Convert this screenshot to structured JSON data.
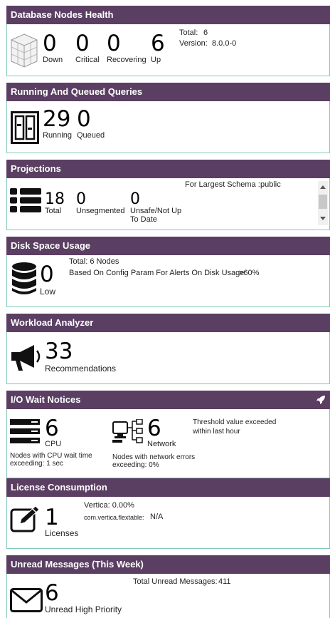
{
  "db": {
    "title": "Database Nodes Health",
    "metrics": [
      {
        "value": "0",
        "label": "Down"
      },
      {
        "value": "0",
        "label": "Critical"
      },
      {
        "value": "0",
        "label": "Recovering"
      },
      {
        "value": "6",
        "label": "Up"
      }
    ],
    "total_label": "Total:",
    "total_value": "6",
    "version_label": "Version:",
    "version_value": "8.0.0-0"
  },
  "queries": {
    "title": "Running And Queued Queries",
    "running_value": "29",
    "running_label": "Running",
    "queued_value": "0",
    "queued_label": "Queued"
  },
  "projections": {
    "title": "Projections",
    "total_value": "18",
    "total_label": "Total",
    "unseg_value": "0",
    "unseg_label": "Unsegmented",
    "unsafe_value": "0",
    "unsafe_label_1": "Unsafe/Not Up",
    "unsafe_label_2": "To Date",
    "schema_label": "For Largest Schema :",
    "schema_value": "public"
  },
  "disk": {
    "title": "Disk Space Usage",
    "value": "0",
    "label": "Low",
    "total_line": "Total:   6 Nodes",
    "config_line": "Based On Config Param For Alerts On Disk Usage:",
    "config_value": ">60%"
  },
  "workload": {
    "title": "Workload Analyzer",
    "value": "33",
    "label": "Recommendations"
  },
  "io": {
    "title": "I/O Wait Notices",
    "cpu_value": "6",
    "cpu_label": "CPU",
    "cpu_note_1": "Nodes with CPU wait time",
    "cpu_note_2": "exceeding: 1 sec",
    "net_value": "6",
    "net_label": "Network",
    "net_note_1": "Nodes with network errors",
    "net_note_2": "exceeding: 0%",
    "threshold_1": "Threshold value exceeded",
    "threshold_2": "within last hour"
  },
  "license": {
    "title": "License Consumption",
    "value": "1",
    "label": "Licenses",
    "vertica_line": "Vertica:  0.00%",
    "flex_label": "com.vertica.flextable:",
    "flex_value": "N/A"
  },
  "messages": {
    "title": "Unread Messages (This Week)",
    "value": "6",
    "label": "Unread High Priority",
    "total_label": "Total Unread Messages:",
    "total_value": "411"
  },
  "colors": {
    "header": "#5b3f63",
    "border": "#7fc8b8"
  }
}
